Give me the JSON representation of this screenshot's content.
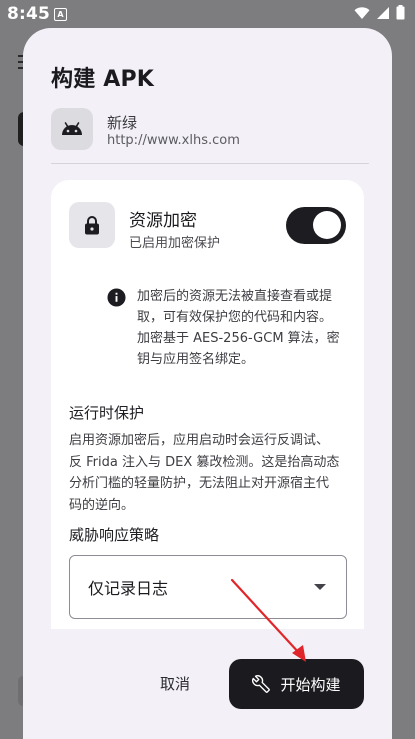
{
  "status_bar": {
    "time": "8:45",
    "notification_glyph": "A"
  },
  "dialog": {
    "title": "构建 APK",
    "app": {
      "name": "新绿",
      "url": "http://www.xlhs.com",
      "icon": "android-icon"
    },
    "encryption": {
      "title": "资源加密",
      "subtitle": "已启用加密保护",
      "enabled": true,
      "icon": "lock-icon",
      "info_lines": [
        "加密后的资源无法被直接查看或提",
        "取，可有效保护您的代码和内容。",
        "加密基于 AES-256-GCM 算法，密",
        "钥与应用签名绑定。"
      ]
    },
    "runtime": {
      "title": "运行时保护",
      "desc_lines": [
        "启用资源加密后，应用启动时会运行反调试、",
        "反 Frida 注入与 DEX 篡改检测。这是抬高动态",
        "分析门槛的轻量防护，无法阻止对开源宿主代",
        "码的逆向。"
      ]
    },
    "threat": {
      "title": "威胁响应策略",
      "selected": "仅记录日志"
    },
    "actions": {
      "cancel": "取消",
      "start": "开始构建",
      "start_icon": "wrench-icon"
    }
  },
  "colors": {
    "accent_dark": "#1b1a1f",
    "dialog_bg": "#f3f1f7",
    "annotation_arrow": "#e0262a"
  }
}
